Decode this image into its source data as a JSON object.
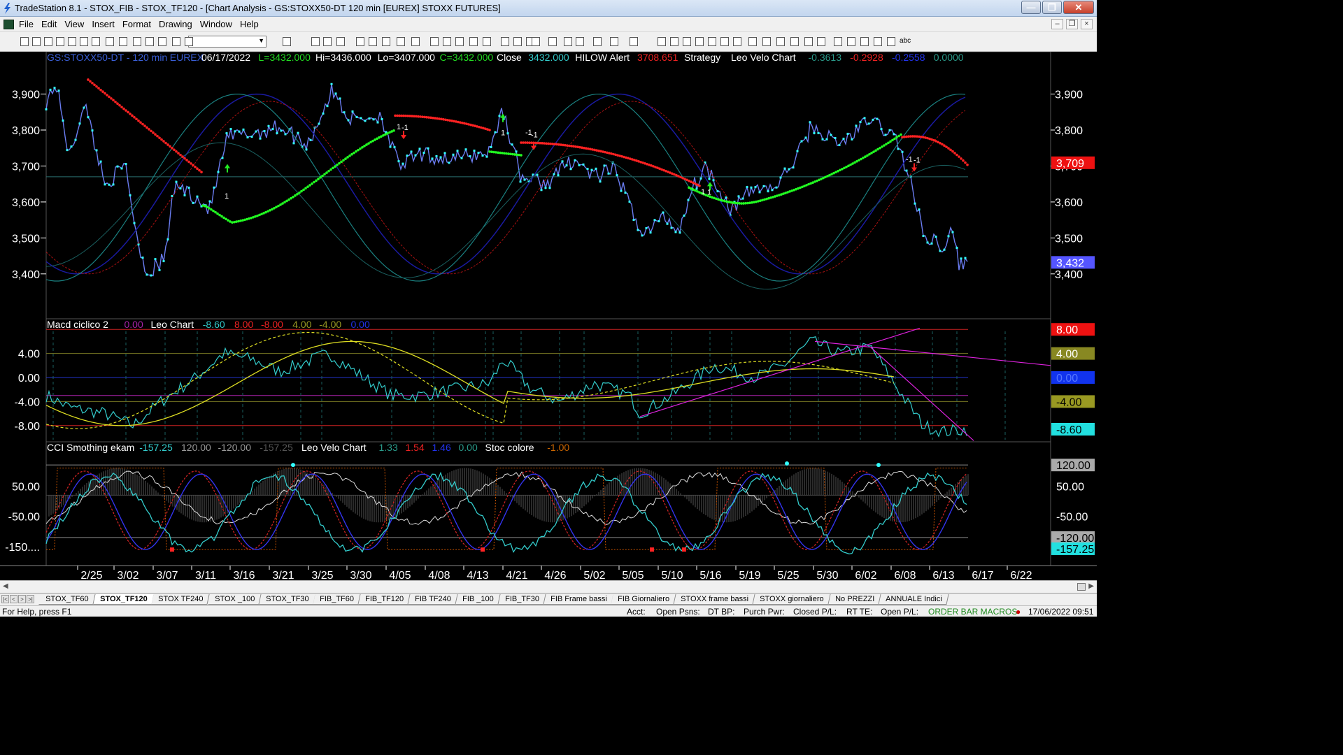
{
  "window": {
    "title": "TradeStation 8.1 - STOX_FIB - STOX_TF120 - [Chart Analysis - GS:STOXX50-DT  120 min  [EUREX] STOXX FUTURES]"
  },
  "menu": [
    "File",
    "Edit",
    "View",
    "Insert",
    "Format",
    "Drawing",
    "Window",
    "Help"
  ],
  "toolbar": {
    "combo_value": "",
    "text_tool": "abc"
  },
  "price_panel": {
    "header": [
      {
        "text": "GS:STOXX50-DT - 120 min",
        "color": "#3a5fd8"
      },
      {
        "text": "EUREX",
        "color": "#3a5fd8"
      },
      {
        "text": "06/17/2022",
        "color": "#ffffff"
      },
      {
        "text": "L=3432.000",
        "color": "#22dd22"
      },
      {
        "text": "Hi=3436.000",
        "color": "#ffffff"
      },
      {
        "text": "Lo=3407.000",
        "color": "#ffffff"
      },
      {
        "text": "C=3432.000",
        "color": "#22dd22"
      },
      {
        "text": "Close",
        "color": "#ffffff"
      },
      {
        "text": "3432.000",
        "color": "#33cccc"
      },
      {
        "text": "HILOW Alert",
        "color": "#ffffff"
      },
      {
        "text": "3708.651",
        "color": "#ee2222"
      },
      {
        "text": "Strategy",
        "color": "#ffffff"
      },
      {
        "text": "Leo Velo Chart",
        "color": "#ffffff"
      },
      {
        "text": "-0.3613",
        "color": "#2a9a8a"
      },
      {
        "text": "-0.2928",
        "color": "#ee2222"
      },
      {
        "text": "-0.2558",
        "color": "#2233ee"
      },
      {
        "text": "0.0000",
        "color": "#2a9a8a"
      }
    ],
    "y_ticks": [
      "3,900",
      "3,800",
      "3,700",
      "3,600",
      "3,500",
      "3,400"
    ],
    "y_tick_values": [
      3900,
      3800,
      3700,
      3600,
      3500,
      3400
    ],
    "price_labels": [
      {
        "text": "3,709",
        "value": 3709,
        "bg": "#ee1111",
        "fg": "#ffffff"
      },
      {
        "text": "3,432",
        "value": 3432,
        "bg": "#5555ff",
        "fg": "#ffffff"
      }
    ],
    "signal_labels": [
      "-1",
      "1",
      "1",
      "-1",
      "1",
      "-1",
      "1",
      "-1",
      "1",
      "-1"
    ]
  },
  "macd_panel": {
    "header": [
      {
        "text": "Macd ciclico 2",
        "color": "#ffffff"
      },
      {
        "text": "0.00",
        "color": "#aa22aa"
      },
      {
        "text": "Leo Chart",
        "color": "#ffffff"
      },
      {
        "text": "-8.60",
        "color": "#33cccc"
      },
      {
        "text": "8.00",
        "color": "#ee2222"
      },
      {
        "text": "-8.00",
        "color": "#ee2222"
      },
      {
        "text": "4.00",
        "color": "#999922"
      },
      {
        "text": "-4.00",
        "color": "#999922"
      },
      {
        "text": "0.00",
        "color": "#2233ee"
      }
    ],
    "y_ticks": [
      "4.00",
      "0.00",
      "-4.00",
      "-8.00"
    ],
    "y_tick_values": [
      4,
      0,
      -4,
      -8
    ],
    "right_labels": [
      {
        "text": "8.00",
        "value": 8,
        "bg": "#ee1111",
        "fg": "#ffffff"
      },
      {
        "text": "4.00",
        "value": 4,
        "bg": "#888822",
        "fg": "#ffffff"
      },
      {
        "text": "0.00",
        "value": 0,
        "bg": "#1133ee",
        "fg": "#5577ff"
      },
      {
        "text": "-4.00",
        "value": -4,
        "bg": "#999922",
        "fg": "#000000"
      },
      {
        "text": "-8.60",
        "value": -8.6,
        "bg": "#22e0e0",
        "fg": "#000000"
      }
    ]
  },
  "cci_panel": {
    "header": [
      {
        "text": "CCI Smothing ekam",
        "color": "#ffffff"
      },
      {
        "text": "-157.25",
        "color": "#33cccc"
      },
      {
        "text": "120.00",
        "color": "#999999"
      },
      {
        "text": "-120.00",
        "color": "#999999"
      },
      {
        "text": "-157.25",
        "color": "#555555"
      },
      {
        "text": "Leo Velo Chart",
        "color": "#ffffff"
      },
      {
        "text": "1.33",
        "color": "#2a9a8a"
      },
      {
        "text": "1.54",
        "color": "#ee2222"
      },
      {
        "text": "1.46",
        "color": "#2233ee"
      },
      {
        "text": "0.00",
        "color": "#2a9a8a"
      },
      {
        "text": "Stoc colore",
        "color": "#ffffff"
      },
      {
        "text": "-1.00",
        "color": "#cc6600"
      }
    ],
    "y_ticks": [
      "50.00",
      "-50.00",
      "-150...."
    ],
    "y_tick_values": [
      50,
      -50,
      -150
    ],
    "right_labels": [
      {
        "text": "120.00",
        "value": 120,
        "bg": "#aaaaaa",
        "fg": "#000000"
      },
      {
        "text": "50.00",
        "value": 50,
        "bg": "#000000",
        "fg": "#ffffff"
      },
      {
        "text": "-50.00",
        "value": -50,
        "bg": "#000000",
        "fg": "#ffffff"
      },
      {
        "text": "-120.00",
        "value": -120,
        "bg": "#aaaaaa",
        "fg": "#000000"
      },
      {
        "text": "-157.25",
        "value": -157.25,
        "bg": "#22e0e0",
        "fg": "#000000"
      }
    ]
  },
  "x_axis": [
    "2/25",
    "3/02",
    "3/07",
    "3/11",
    "3/16",
    "3/21",
    "3/25",
    "3/30",
    "4/05",
    "4/08",
    "4/13",
    "4/21",
    "4/26",
    "5/02",
    "5/05",
    "5/10",
    "5/16",
    "5/19",
    "5/25",
    "5/30",
    "6/02",
    "6/08",
    "6/13",
    "6/17",
    "6/22"
  ],
  "tabs": [
    "STOX_TF60",
    "STOX_TF120",
    "STOX TF240",
    "STOX _100",
    "STOX_TF30",
    "FIB_TF60",
    "FIB_TF120",
    "FIB TF240",
    "FIB _100",
    "FIB_TF30",
    "FIB Frame bassi",
    "FIB Giornaliero",
    "STOXX frame bassi",
    "STOXX giornaliero",
    "No PREZZI",
    "ANNUALE Indici"
  ],
  "active_tab": "STOX_TF120",
  "status": {
    "help": "For Help, press F1",
    "acct": "Acct:",
    "open_psns": "Open Psns:",
    "dt_bp": "DT BP:",
    "purch_pwr": "Purch Pwr:",
    "closed_pl": "Closed P/L:",
    "rt_te": "RT TE:",
    "open_pl": "Open P/L:",
    "macros": "ORDER BAR  MACROS",
    "datetime": "17/06/2022 09:51"
  },
  "colors": {
    "price": "#6a7cf0",
    "dots": "#33ffff",
    "trail_green": "#22ff22",
    "trail_red": "#ff2222",
    "band_blue": "#1a1aa0",
    "band_teal": "#1a8080",
    "macd_cyan": "#33cccc",
    "macd_yellow": "#dddd22",
    "trend_magenta": "#dd22dd"
  }
}
